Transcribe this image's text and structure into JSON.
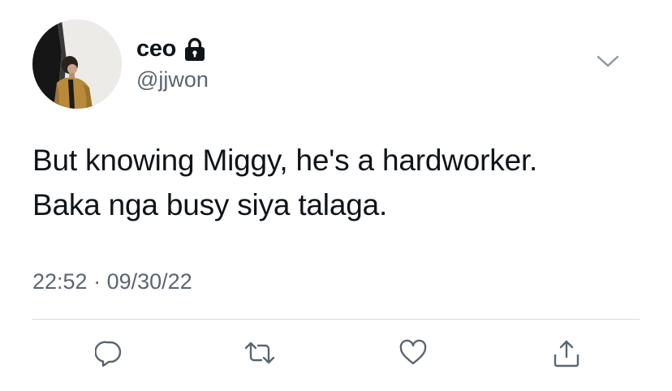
{
  "user": {
    "display_name": "ceo",
    "handle": "@jjwon",
    "protected_icon": "lock-icon",
    "avatar": "profile-photo"
  },
  "tweet": {
    "lines": [
      "But knowing Miggy, he's a hardworker.",
      "Baka nga busy siya talaga."
    ],
    "time": "22:52",
    "separator": "·",
    "date": "09/30/22"
  },
  "menu_icon": "chevron-down-icon",
  "actions": [
    {
      "name": "reply",
      "icon": "reply-icon"
    },
    {
      "name": "retweet",
      "icon": "retweet-icon"
    },
    {
      "name": "like",
      "icon": "heart-icon"
    },
    {
      "name": "share",
      "icon": "share-icon"
    }
  ],
  "colors": {
    "text": "#0f1419",
    "secondary": "#5b6570",
    "divider": "#d6d9dc",
    "icon": "#5b6570"
  }
}
